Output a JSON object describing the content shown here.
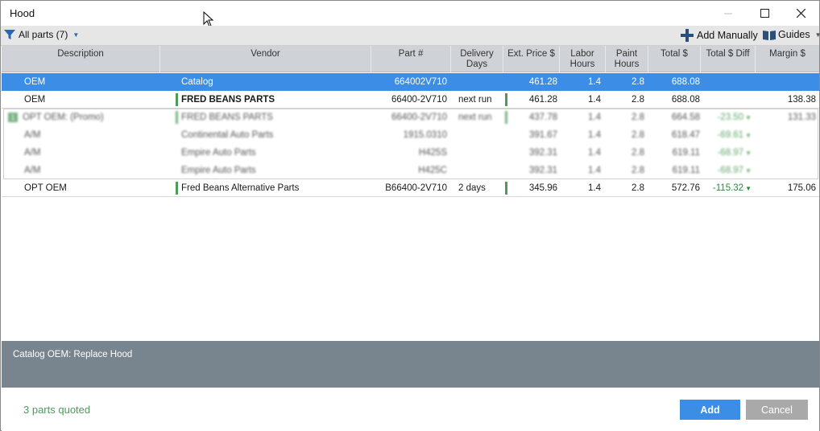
{
  "window": {
    "title": "Hood"
  },
  "toolbar": {
    "filter_label": "All parts (7)",
    "add_manually_label": "Add Manually",
    "guides_label": "Guides"
  },
  "columns": [
    "Description",
    "Vendor",
    "Part #",
    "Delivery Days",
    "Ext. Price $",
    "Labor Hours",
    "Paint Hours",
    "Total $",
    "Total $ Diff",
    "Margin $"
  ],
  "rows": [
    {
      "description": "OEM",
      "vendor": "Catalog",
      "part": "664002V710",
      "delivery": "",
      "price": "461.28",
      "labor": "1.4",
      "paint": "2.8",
      "total": "688.08",
      "diff": "",
      "margin": ""
    },
    {
      "description": "OEM",
      "vendor": "FRED BEANS PARTS",
      "part": "66400-2V710",
      "delivery": "next run",
      "price": "461.28",
      "labor": "1.4",
      "paint": "2.8",
      "total": "688.08",
      "diff": "",
      "margin": "138.38"
    },
    {
      "badge": "1",
      "description": "OPT OEM: (Promo)",
      "vendor": "FRED BEANS PARTS",
      "part": "66400-2V710",
      "delivery": "next run",
      "price": "437.78",
      "labor": "1.4",
      "paint": "2.8",
      "total": "664.58",
      "diff": "-23.50",
      "margin": "131.33"
    },
    {
      "description": "A/M",
      "vendor": "Continental Auto Parts",
      "part": "1915.0310",
      "delivery": "",
      "price": "391.67",
      "labor": "1.4",
      "paint": "2.8",
      "total": "618.47",
      "diff": "-69.61",
      "margin": ""
    },
    {
      "description": "A/M",
      "vendor": "Empire Auto Parts",
      "part": "H425S",
      "delivery": "",
      "price": "392.31",
      "labor": "1.4",
      "paint": "2.8",
      "total": "619.11",
      "diff": "-68.97",
      "margin": ""
    },
    {
      "description": "A/M",
      "vendor": "Empire Auto Parts",
      "part": "H425C",
      "delivery": "",
      "price": "392.31",
      "labor": "1.4",
      "paint": "2.8",
      "total": "619.11",
      "diff": "-68.97",
      "margin": ""
    },
    {
      "description": "OPT OEM",
      "vendor": "Fred Beans Alternative Parts",
      "part": "B66400-2V710",
      "delivery": "2 days",
      "price": "345.96",
      "labor": "1.4",
      "paint": "2.8",
      "total": "572.76",
      "diff": "-115.32",
      "margin": "175.06"
    }
  ],
  "description_panel": {
    "text": "Catalog OEM: Replace Hood"
  },
  "footer": {
    "status": "3 parts quoted",
    "add_label": "Add",
    "cancel_label": "Cancel"
  },
  "colors": {
    "accent": "#3b8de5",
    "green": "#4e9a5c",
    "panel": "#78848e"
  }
}
